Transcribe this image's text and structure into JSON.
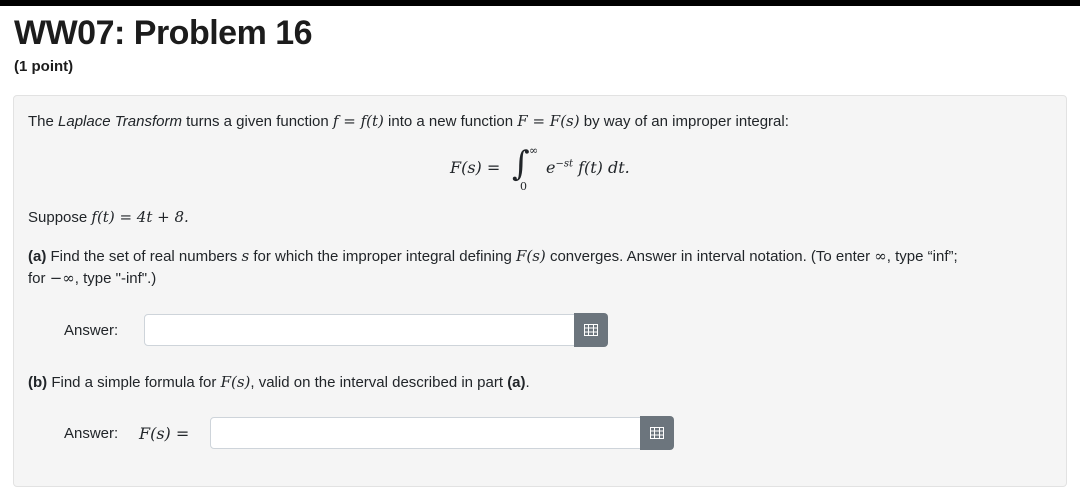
{
  "header": {
    "title": "WW07: Problem 16",
    "points": "(1 point)"
  },
  "problem": {
    "intro_pre": "The ",
    "intro_em": "Laplace Transform",
    "intro_mid1": " turns a given function ",
    "intro_f": "f = f(t)",
    "intro_mid2": " into a new function ",
    "intro_F": "F = F(s)",
    "intro_post": " by way of an improper integral:",
    "formula_left": "F(s) =",
    "formula_integral": "∫",
    "formula_upper": "∞",
    "formula_lower": "0",
    "formula_e": "e",
    "formula_exp": "−st",
    "formula_rest": " f(t) dt.",
    "suppose_text": "Suppose ",
    "suppose_math": "f(t) = 4t + 8.",
    "part_a_label": "(a)",
    "part_a_text1": " Find the set of real numbers ",
    "part_a_s": "s",
    "part_a_text2": " for which the improper integral defining ",
    "part_a_Fs": "F(s)",
    "part_a_text3": " converges. Answer in interval notation. (To enter ",
    "part_a_inf": "∞",
    "part_a_text4": ", type “inf”;",
    "part_a_line2_pre": "for ",
    "part_a_neginf": "−∞",
    "part_a_line2_post": ", type \"-inf\".)",
    "answer_label": "Answer:",
    "part_b_label": "(b)",
    "part_b_text1": " Find a simple formula for ",
    "part_b_Fs": "F(s)",
    "part_b_text2": ", valid on the interval described in part ",
    "part_b_ref": "(a)",
    "part_b_end": ".",
    "answer_b_label": "Answer:",
    "answer_b_prefix": "F(s) =",
    "answer_a_value": "",
    "answer_b_value": ""
  },
  "icons": {
    "equation_editor": "calculator-grid-icon"
  },
  "colors": {
    "card_bg": "#f5f5f5",
    "button_bg": "#6c757d"
  }
}
